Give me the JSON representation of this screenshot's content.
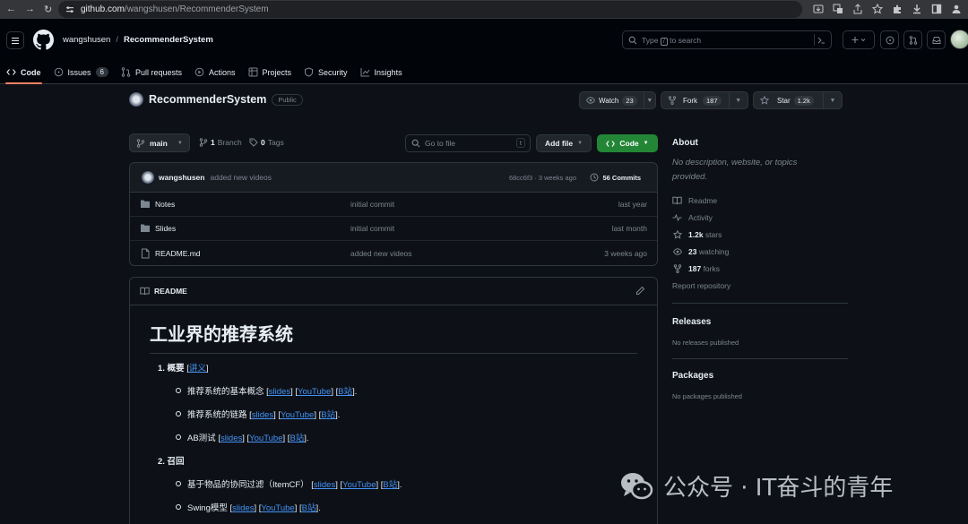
{
  "browser": {
    "url_domain": "github.com",
    "url_path": "/wangshusen/RecommenderSystem"
  },
  "header": {
    "owner": "wangshusen",
    "separator": "/",
    "repo": "RecommenderSystem",
    "search_prefix": "Type",
    "search_key": "/",
    "search_suffix": "to search"
  },
  "tabs": [
    {
      "label": "Code",
      "icon": "code-icon"
    },
    {
      "label": "Issues",
      "icon": "issue-icon",
      "count": "6"
    },
    {
      "label": "Pull requests",
      "icon": "pull-request-icon"
    },
    {
      "label": "Actions",
      "icon": "play-icon"
    },
    {
      "label": "Projects",
      "icon": "table-icon"
    },
    {
      "label": "Security",
      "icon": "shield-icon"
    },
    {
      "label": "Insights",
      "icon": "graph-icon"
    }
  ],
  "repo": {
    "name": "RecommenderSystem",
    "visibility": "Public",
    "watch_label": "Watch",
    "watch_count": "23",
    "fork_label": "Fork",
    "fork_count": "187",
    "star_label": "Star",
    "star_count": "1.2k"
  },
  "toolbar": {
    "branch": "main",
    "branches_count": "1",
    "branches_label": "Branch",
    "tags_count": "0",
    "tags_label": "Tags",
    "goto_placeholder": "Go to file",
    "goto_key": "t",
    "add_file": "Add file",
    "code": "Code"
  },
  "commit": {
    "author": "wangshusen",
    "message": "added new videos",
    "sha_time": "68cc6f3 · 3 weeks ago",
    "commits": "56 Commits"
  },
  "files": [
    {
      "name": "Notes",
      "type": "folder",
      "message": "initial commit",
      "date": "last year"
    },
    {
      "name": "Slides",
      "type": "folder",
      "message": "initial commit",
      "date": "last month"
    },
    {
      "name": "README.md",
      "type": "file",
      "message": "added new videos",
      "date": "3 weeks ago"
    }
  ],
  "readme": {
    "tab_label": "README",
    "title": "工业界的推荐系统",
    "item1_label": "1. 概要 ",
    "item1_link": "讲义",
    "sub1": {
      "text": "推荐系统的基本概念 ",
      "l1": "slides",
      "l2": "YouTube",
      "l3": "B站"
    },
    "sub2": {
      "text": "推荐系统的链路 ",
      "l1": "slides",
      "l2": "YouTube",
      "l3": "B站"
    },
    "sub3": {
      "text": "AB测试 ",
      "l1": "slides",
      "l2": "YouTube",
      "l3": "B站"
    },
    "item2_label": "2. 召回",
    "sub4": {
      "text": "基于物品的协同过滤（ItemCF） ",
      "l1": "slides",
      "l2": "YouTube",
      "l3": "B站"
    },
    "sub5": {
      "text": "Swing模型 ",
      "l1": "slides",
      "l2": "YouTube",
      "l3": "B站"
    }
  },
  "about": {
    "title": "About",
    "description": "No description, website, or topics provided.",
    "readme": "Readme",
    "activity": "Activity",
    "stars_count": "1.2k",
    "stars_label": "stars",
    "watching_count": "23",
    "watching_label": "watching",
    "forks_count": "187",
    "forks_label": "forks",
    "report": "Report repository"
  },
  "releases": {
    "title": "Releases",
    "empty": "No releases published"
  },
  "packages": {
    "title": "Packages",
    "empty": "No packages published"
  },
  "watermark": {
    "text": "公众号 · IT奋斗的青年"
  },
  "colors": {
    "accent": "#238636",
    "link": "#4493f8",
    "tab_underline": "#f78166",
    "background": "#0d1117"
  }
}
